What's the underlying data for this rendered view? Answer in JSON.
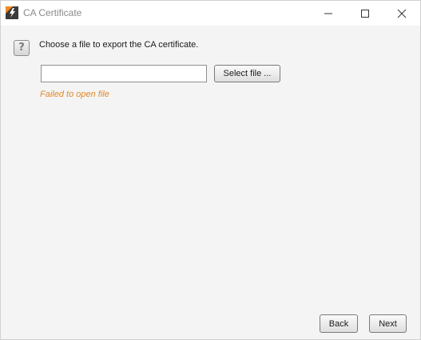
{
  "window": {
    "title": "CA Certificate",
    "app_icon": "lightning-app-icon",
    "controls": {
      "minimize_icon": "minimize-icon",
      "maximize_icon": "maximize-icon",
      "close_icon": "close-icon"
    }
  },
  "dialog": {
    "help_glyph": "?",
    "instruction": "Choose a file to export the CA certificate.",
    "file_input": {
      "value": "",
      "placeholder": ""
    },
    "select_file_label": "Select file ...",
    "error_message": "Failed to open file"
  },
  "footer": {
    "back_label": "Back",
    "next_label": "Next"
  },
  "colors": {
    "error": "#e0892a",
    "app_icon_orange": "#f08a24",
    "app_icon_dark": "#3a3a3a",
    "background": "#f4f4f4"
  }
}
